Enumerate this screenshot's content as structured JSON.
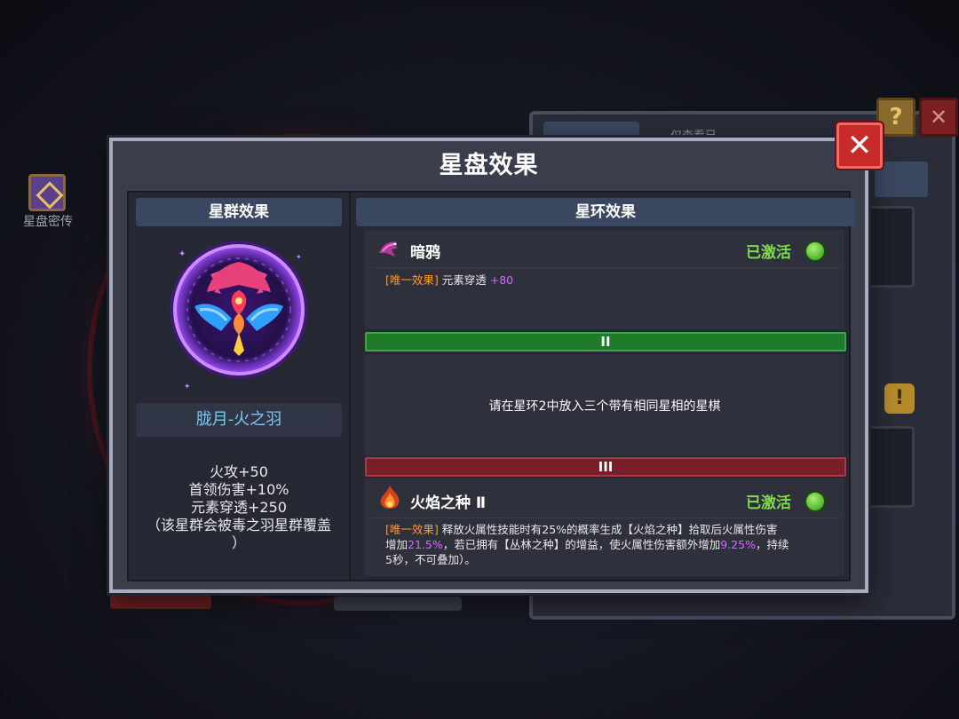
{
  "sidebar": {
    "secret_label": "星盘密传"
  },
  "background": {
    "filter_label": "仅查看已",
    "help_glyph": "?",
    "close_glyph": "✕",
    "warn_glyph": "!"
  },
  "modal": {
    "title": "星盘效果",
    "close_glyph": "✕",
    "left": {
      "header": "星群效果",
      "constellation_name": "胧月-火之羽",
      "stats": [
        "火攻+50",
        "首领伤害+10%",
        "元素穿透+250",
        "（该星群会被毒之羽星群覆盖",
        "）"
      ]
    },
    "right": {
      "header": "星环效果",
      "ring1": {
        "name": "暗鸦",
        "status": "已激活",
        "effect_tag": "[唯一效果]",
        "effect_text": "元素穿透",
        "effect_value": "+80"
      },
      "ring2": {
        "numeral": "II",
        "hint": "请在星环2中放入三个带有相同星相的星棋"
      },
      "ring3": {
        "numeral": "III",
        "name": "火焰之种 Ⅱ",
        "status": "已激活",
        "effect_tag": "[唯一效果]",
        "text_a": "释放火属性技能时有25%的概率生成【火焰之种】拾取后火属性伤害",
        "text_b": "增加",
        "value_1": "21.5%",
        "text_c": "，若已拥有【丛林之种】的增益，使火属性伤害额外增加",
        "value_2": "9.25%",
        "text_d": "，持续",
        "text_e": "5秒，不可叠加）。"
      }
    }
  },
  "colors": {
    "accent_blue": "#3a4760",
    "active_green": "#7fdc4a",
    "ring2_green": "#1f7a2a",
    "ring3_red": "#7a1f2a",
    "tag_orange": "#ff9a2a",
    "value_purple": "#d36aff"
  }
}
